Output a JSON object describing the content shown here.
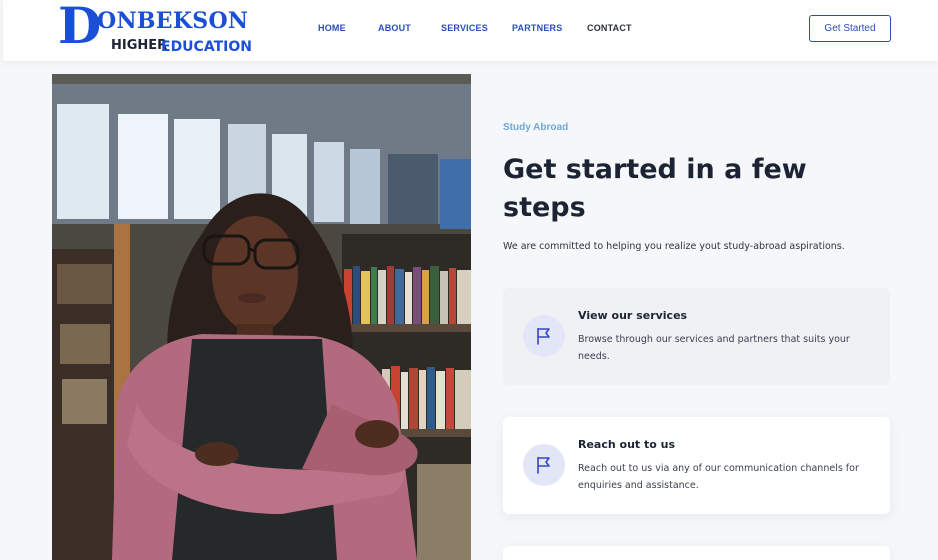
{
  "brand": {
    "logo_letter": "D",
    "logo_rest": "ONBEKSON",
    "logo_higher": "HIGHER",
    "logo_education": "EDUCATION",
    "primary_color": "#1a4fd6"
  },
  "nav": {
    "items": [
      {
        "label": "HOME"
      },
      {
        "label": "ABOUT"
      },
      {
        "label": "SERVICES"
      },
      {
        "label": "PARTNERS"
      },
      {
        "label": "CONTACT"
      }
    ],
    "cta_label": "Get Started"
  },
  "hero": {
    "eyebrow": "Study Abroad",
    "headline": "Get started in a few steps",
    "subtitle": "We are committed to helping you realize yout study-abroad aspirations."
  },
  "cards": [
    {
      "title": "View our services",
      "description": "Browse through our services and partners that suits your needs.",
      "icon": "flag-icon"
    },
    {
      "title": "Reach out to us",
      "description": "Reach out to us via any of our communication channels for enquiries and assistance.",
      "icon": "flag-icon"
    }
  ]
}
